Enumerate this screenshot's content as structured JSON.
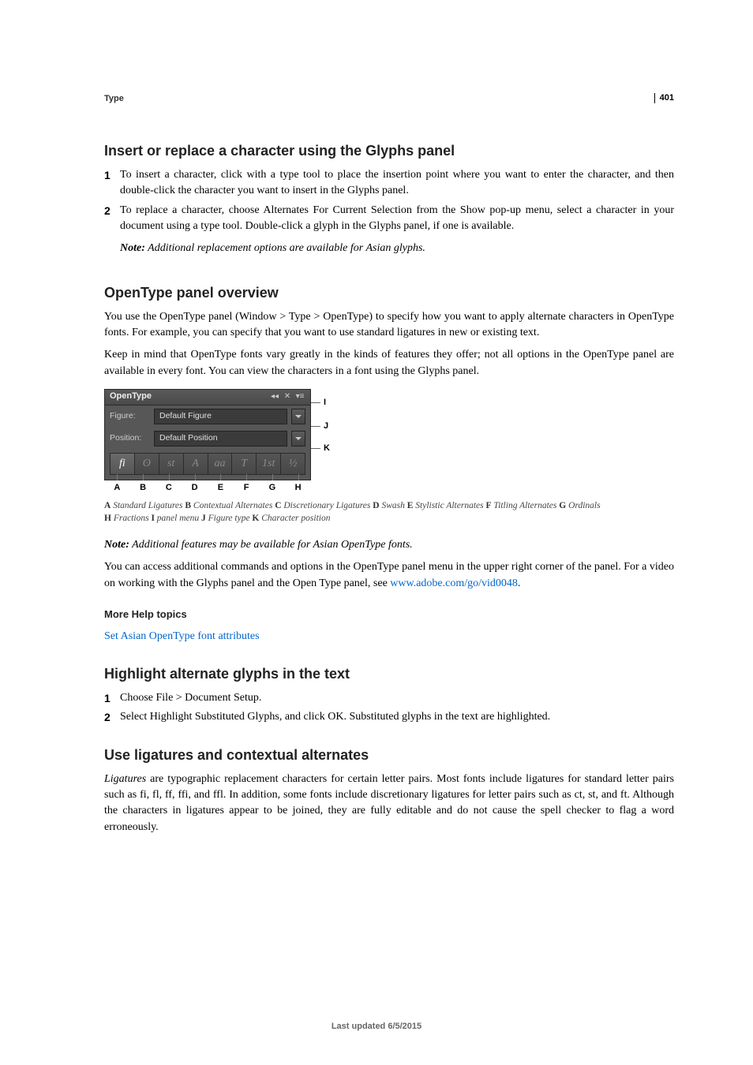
{
  "breadcrumb": "Type",
  "page_number": "401",
  "sections": {
    "insert": {
      "title": "Insert or replace a character using the Glyphs panel",
      "step1_num": "1",
      "step1": "To insert a character, click with a type tool to place the insertion point where you want to enter the character, and then double-click the character you want to insert in the Glyphs panel.",
      "step2_num": "2",
      "step2": "To replace a character, choose Alternates For Current Selection from the Show pop-up menu, select a character in your document using a type tool. Double-click a glyph in the Glyphs panel, if one is available.",
      "note_label": "Note:",
      "note": " Additional replacement options are available for Asian glyphs."
    },
    "overview": {
      "title": "OpenType panel overview",
      "p1": "You use the OpenType panel (Window > Type > OpenType) to specify how you want to apply alternate characters in OpenType fonts. For example, you can specify that you want to use standard ligatures in new or existing text.",
      "p2": "Keep in mind that OpenType fonts vary greatly in the kinds of features they offer; not all options in the OpenType panel are available in every font. You can view the characters in a font using the Glyphs panel.",
      "panel": {
        "title": "OpenType",
        "figure_label": "Figure:",
        "figure_value": "Default Figure",
        "position_label": "Position:",
        "position_value": "Default Position",
        "buttons": [
          "fi",
          "ʘ",
          "st",
          "A",
          "aa",
          "T",
          "1st",
          "½"
        ],
        "bottom": [
          "A",
          "B",
          "C",
          "D",
          "E",
          "F",
          "G",
          "H"
        ],
        "right": [
          "I",
          "J",
          "K"
        ]
      },
      "caption_parts": {
        "A_l": "A",
        "A_t": " Standard Ligatures  ",
        "B_l": "B",
        "B_t": " Contextual Alternates  ",
        "C_l": "C",
        "C_t": " Discretionary Ligatures  ",
        "D_l": "D",
        "D_t": " Swash  ",
        "E_l": "E",
        "E_t": " Stylistic Alternates  ",
        "F_l": "F",
        "F_t": " Titling Alternates  ",
        "G_l": "G",
        "G_t": " Ordinals  ",
        "H_l": "H",
        "H_t": " Fractions  ",
        "I_l": "I",
        "I_t": " panel menu  ",
        "J_l": "J",
        "J_t": " Figure type  ",
        "K_l": "K",
        "K_t": " Character position"
      },
      "note_label": "Note:",
      "note": " Additional features may be available for Asian OpenType fonts.",
      "p3a": "You can access additional commands and options in the OpenType panel menu in the upper right corner of the panel. For a video on working with the Glyphs panel and the Open Type panel, see ",
      "p3_link": "www.adobe.com/go/vid0048",
      "p3b": "."
    },
    "more_help": {
      "title": "More Help topics",
      "link": "Set Asian OpenType font attributes"
    },
    "highlight": {
      "title": "Highlight alternate glyphs in the text",
      "step1_num": "1",
      "step1": "Choose File > Document Setup.",
      "step2_num": "2",
      "step2": "Select Highlight Substituted Glyphs, and click OK. Substituted glyphs in the text are highlighted."
    },
    "ligatures": {
      "title": "Use ligatures and contextual alternates",
      "p1a": "Ligatures",
      "p1b": " are typographic replacement characters for certain letter pairs. Most fonts include ligatures for standard letter pairs such as fi, fl, ff, ffi, and ffl. In addition, some fonts include discretionary ligatures for letter pairs such as ct, st, and ft. Although the characters in ligatures appear to be joined, they are fully editable and do not cause the spell checker to flag a word erroneously."
    }
  },
  "footer": "Last updated 6/5/2015"
}
